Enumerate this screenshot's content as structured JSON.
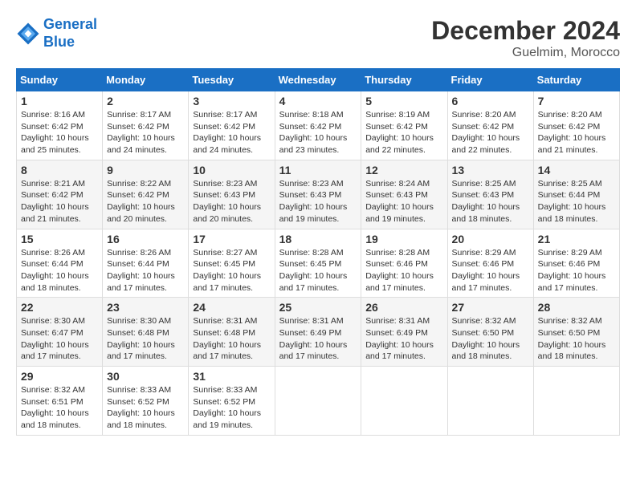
{
  "logo": {
    "line1": "General",
    "line2": "Blue"
  },
  "title": "December 2024",
  "location": "Guelmim, Morocco",
  "days_of_week": [
    "Sunday",
    "Monday",
    "Tuesday",
    "Wednesday",
    "Thursday",
    "Friday",
    "Saturday"
  ],
  "weeks": [
    [
      {
        "day": "1",
        "info": "Sunrise: 8:16 AM\nSunset: 6:42 PM\nDaylight: 10 hours\nand 25 minutes."
      },
      {
        "day": "2",
        "info": "Sunrise: 8:17 AM\nSunset: 6:42 PM\nDaylight: 10 hours\nand 24 minutes."
      },
      {
        "day": "3",
        "info": "Sunrise: 8:17 AM\nSunset: 6:42 PM\nDaylight: 10 hours\nand 24 minutes."
      },
      {
        "day": "4",
        "info": "Sunrise: 8:18 AM\nSunset: 6:42 PM\nDaylight: 10 hours\nand 23 minutes."
      },
      {
        "day": "5",
        "info": "Sunrise: 8:19 AM\nSunset: 6:42 PM\nDaylight: 10 hours\nand 22 minutes."
      },
      {
        "day": "6",
        "info": "Sunrise: 8:20 AM\nSunset: 6:42 PM\nDaylight: 10 hours\nand 22 minutes."
      },
      {
        "day": "7",
        "info": "Sunrise: 8:20 AM\nSunset: 6:42 PM\nDaylight: 10 hours\nand 21 minutes."
      }
    ],
    [
      {
        "day": "8",
        "info": "Sunrise: 8:21 AM\nSunset: 6:42 PM\nDaylight: 10 hours\nand 21 minutes."
      },
      {
        "day": "9",
        "info": "Sunrise: 8:22 AM\nSunset: 6:42 PM\nDaylight: 10 hours\nand 20 minutes."
      },
      {
        "day": "10",
        "info": "Sunrise: 8:23 AM\nSunset: 6:43 PM\nDaylight: 10 hours\nand 20 minutes."
      },
      {
        "day": "11",
        "info": "Sunrise: 8:23 AM\nSunset: 6:43 PM\nDaylight: 10 hours\nand 19 minutes."
      },
      {
        "day": "12",
        "info": "Sunrise: 8:24 AM\nSunset: 6:43 PM\nDaylight: 10 hours\nand 19 minutes."
      },
      {
        "day": "13",
        "info": "Sunrise: 8:25 AM\nSunset: 6:43 PM\nDaylight: 10 hours\nand 18 minutes."
      },
      {
        "day": "14",
        "info": "Sunrise: 8:25 AM\nSunset: 6:44 PM\nDaylight: 10 hours\nand 18 minutes."
      }
    ],
    [
      {
        "day": "15",
        "info": "Sunrise: 8:26 AM\nSunset: 6:44 PM\nDaylight: 10 hours\nand 18 minutes."
      },
      {
        "day": "16",
        "info": "Sunrise: 8:26 AM\nSunset: 6:44 PM\nDaylight: 10 hours\nand 17 minutes."
      },
      {
        "day": "17",
        "info": "Sunrise: 8:27 AM\nSunset: 6:45 PM\nDaylight: 10 hours\nand 17 minutes."
      },
      {
        "day": "18",
        "info": "Sunrise: 8:28 AM\nSunset: 6:45 PM\nDaylight: 10 hours\nand 17 minutes."
      },
      {
        "day": "19",
        "info": "Sunrise: 8:28 AM\nSunset: 6:46 PM\nDaylight: 10 hours\nand 17 minutes."
      },
      {
        "day": "20",
        "info": "Sunrise: 8:29 AM\nSunset: 6:46 PM\nDaylight: 10 hours\nand 17 minutes."
      },
      {
        "day": "21",
        "info": "Sunrise: 8:29 AM\nSunset: 6:46 PM\nDaylight: 10 hours\nand 17 minutes."
      }
    ],
    [
      {
        "day": "22",
        "info": "Sunrise: 8:30 AM\nSunset: 6:47 PM\nDaylight: 10 hours\nand 17 minutes."
      },
      {
        "day": "23",
        "info": "Sunrise: 8:30 AM\nSunset: 6:48 PM\nDaylight: 10 hours\nand 17 minutes."
      },
      {
        "day": "24",
        "info": "Sunrise: 8:31 AM\nSunset: 6:48 PM\nDaylight: 10 hours\nand 17 minutes."
      },
      {
        "day": "25",
        "info": "Sunrise: 8:31 AM\nSunset: 6:49 PM\nDaylight: 10 hours\nand 17 minutes."
      },
      {
        "day": "26",
        "info": "Sunrise: 8:31 AM\nSunset: 6:49 PM\nDaylight: 10 hours\nand 17 minutes."
      },
      {
        "day": "27",
        "info": "Sunrise: 8:32 AM\nSunset: 6:50 PM\nDaylight: 10 hours\nand 18 minutes."
      },
      {
        "day": "28",
        "info": "Sunrise: 8:32 AM\nSunset: 6:50 PM\nDaylight: 10 hours\nand 18 minutes."
      }
    ],
    [
      {
        "day": "29",
        "info": "Sunrise: 8:32 AM\nSunset: 6:51 PM\nDaylight: 10 hours\nand 18 minutes."
      },
      {
        "day": "30",
        "info": "Sunrise: 8:33 AM\nSunset: 6:52 PM\nDaylight: 10 hours\nand 18 minutes."
      },
      {
        "day": "31",
        "info": "Sunrise: 8:33 AM\nSunset: 6:52 PM\nDaylight: 10 hours\nand 19 minutes."
      },
      null,
      null,
      null,
      null
    ]
  ]
}
